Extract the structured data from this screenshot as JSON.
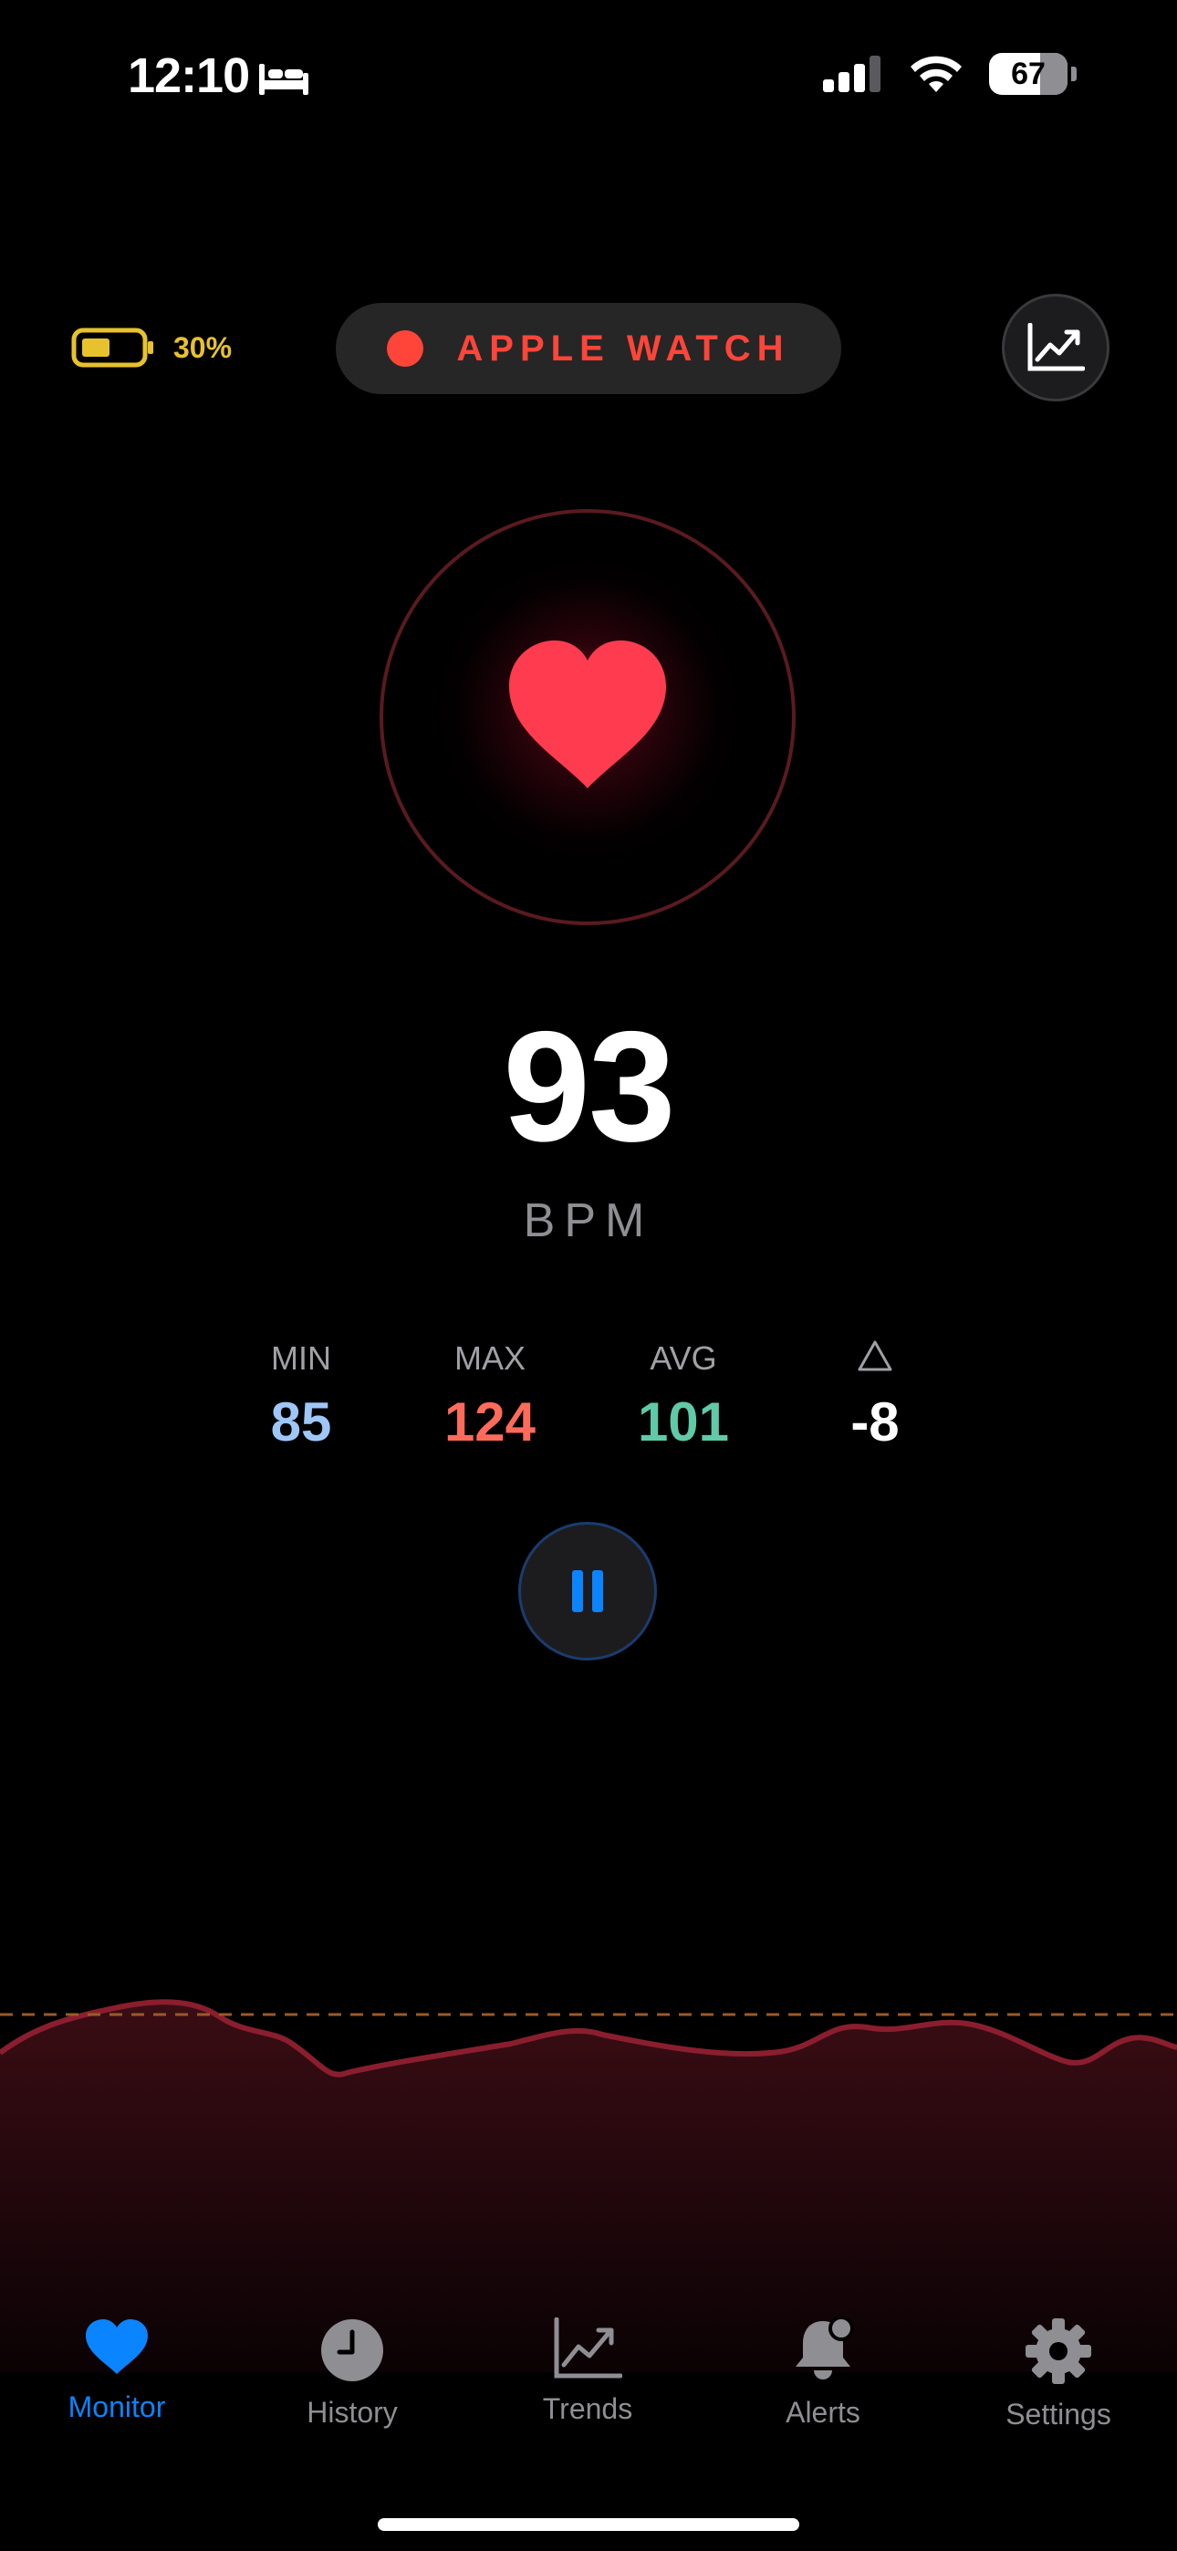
{
  "status_bar": {
    "time": "12:10",
    "battery_level": "67"
  },
  "header": {
    "watch_battery_pct": "30%",
    "device_label": "APPLE WATCH"
  },
  "heart_rate": {
    "value": "93",
    "unit": "BPM"
  },
  "stats": [
    {
      "label": "MIN",
      "value": "85"
    },
    {
      "label": "MAX",
      "value": "124"
    },
    {
      "label": "AVG",
      "value": "101"
    },
    {
      "label": "△",
      "value": "-8"
    }
  ],
  "tabs": [
    {
      "label": "Monitor",
      "icon": "heart-icon",
      "active": true
    },
    {
      "label": "History",
      "icon": "clock-icon",
      "active": false
    },
    {
      "label": "Trends",
      "icon": "chart-icon",
      "active": false
    },
    {
      "label": "Alerts",
      "icon": "bell-icon",
      "active": false
    },
    {
      "label": "Settings",
      "icon": "gear-icon",
      "active": false
    }
  ],
  "colors": {
    "accent_red": "#ff453a",
    "accent_blue": "#0a84ff",
    "battery_yellow": "#e7c22c",
    "min_color": "#9ec7f7",
    "max_color": "#ff6b5a",
    "avg_color": "#5fc9a8"
  }
}
